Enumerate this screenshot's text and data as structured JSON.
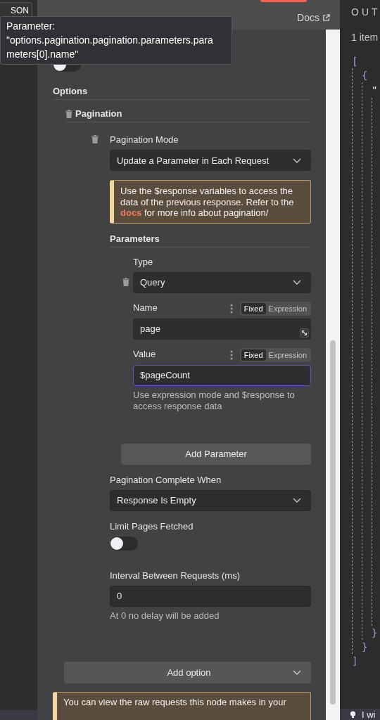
{
  "left_tab": {
    "label": "SON"
  },
  "header": {
    "docs_link": "Docs"
  },
  "tooltip": {
    "lines": [
      "Parameter:",
      "\"options.pagination.pagination.parameters.para",
      "meters[0].name\""
    ]
  },
  "top_toggle": {
    "on": false
  },
  "options": {
    "title": "Options",
    "section": {
      "title": "Pagination",
      "fields": [
        {
          "kind": "select",
          "label": "Pagination Mode",
          "value": "Update a Parameter in Each Request",
          "deletable": true
        },
        {
          "kind": "notice",
          "text": "Use the $response variables to access the data of the previous response. Refer to the",
          "link": "docs",
          "text_after": "for more info about pagination/"
        },
        {
          "kind": "collection",
          "label": "Parameters",
          "items": [
            {
              "fields": [
                {
                  "kind": "select",
                  "label": "Type",
                  "value": "Query",
                  "deletable": true
                },
                {
                  "kind": "input",
                  "label": "Name",
                  "value": "page",
                  "focused": false,
                  "expandable": true,
                  "modes": [
                    {
                      "label": "Fixed",
                      "selected": true
                    },
                    {
                      "label": "Expression",
                      "selected": false
                    }
                  ]
                },
                {
                  "kind": "input",
                  "label": "Value",
                  "value": "$pageCount",
                  "focused": true,
                  "modes": [
                    {
                      "label": "Fixed",
                      "selected": true
                    },
                    {
                      "label": "Expression",
                      "selected": false
                    }
                  ],
                  "hint": "Use expression mode and $response to access response data"
                }
              ]
            }
          ],
          "add_button": "Add Parameter"
        },
        {
          "kind": "select",
          "label": "Pagination Complete When",
          "value": "Response Is Empty"
        },
        {
          "kind": "toggle",
          "label": "Limit Pages Fetched",
          "on": false
        },
        {
          "kind": "input",
          "label": "Interval Between Requests (ms)",
          "value": "0",
          "focused": false,
          "hint": "At 0 no delay will be added"
        }
      ]
    }
  },
  "add_option": {
    "label": "Add option"
  },
  "bottom_notice": {
    "text": "You can view the raw requests this node makes in your"
  },
  "output": {
    "title": "OUT",
    "count": "1 item",
    "json": {
      "open": "[",
      "close": "]",
      "children": [
        {
          "open": "{",
          "close": "}",
          "children": [
            {
              "open": "\"",
              "close": "}"
            }
          ]
        }
      ]
    },
    "hint": "I wi"
  }
}
